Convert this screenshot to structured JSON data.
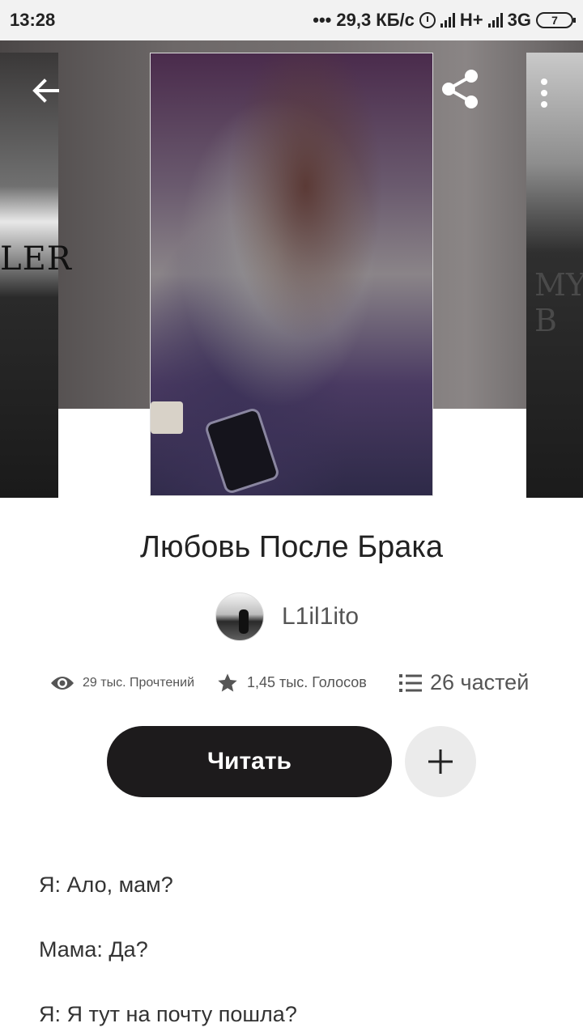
{
  "status_bar": {
    "time": "13:28",
    "speed": "29,3 КБ/с",
    "network1": "H+",
    "network2": "3G",
    "battery": "7"
  },
  "header": {
    "back_icon": "arrow-left-icon",
    "share_icon": "share-icon",
    "more_icon": "more-vertical-icon",
    "left_cover_text": "LER",
    "right_cover_text": "MY B"
  },
  "story": {
    "title": "Любовь После Брака",
    "author": "L1il1ito",
    "reads": "29 тыс. Прочтений",
    "votes": "1,45 тыс. Голосов",
    "parts": "26 частей",
    "read_button": "Читать",
    "add_icon": "plus-icon"
  },
  "excerpt": [
    "Я: Ало, мам?",
    "Мама: Да?",
    "Я: Я тут на почту пошла?"
  ]
}
